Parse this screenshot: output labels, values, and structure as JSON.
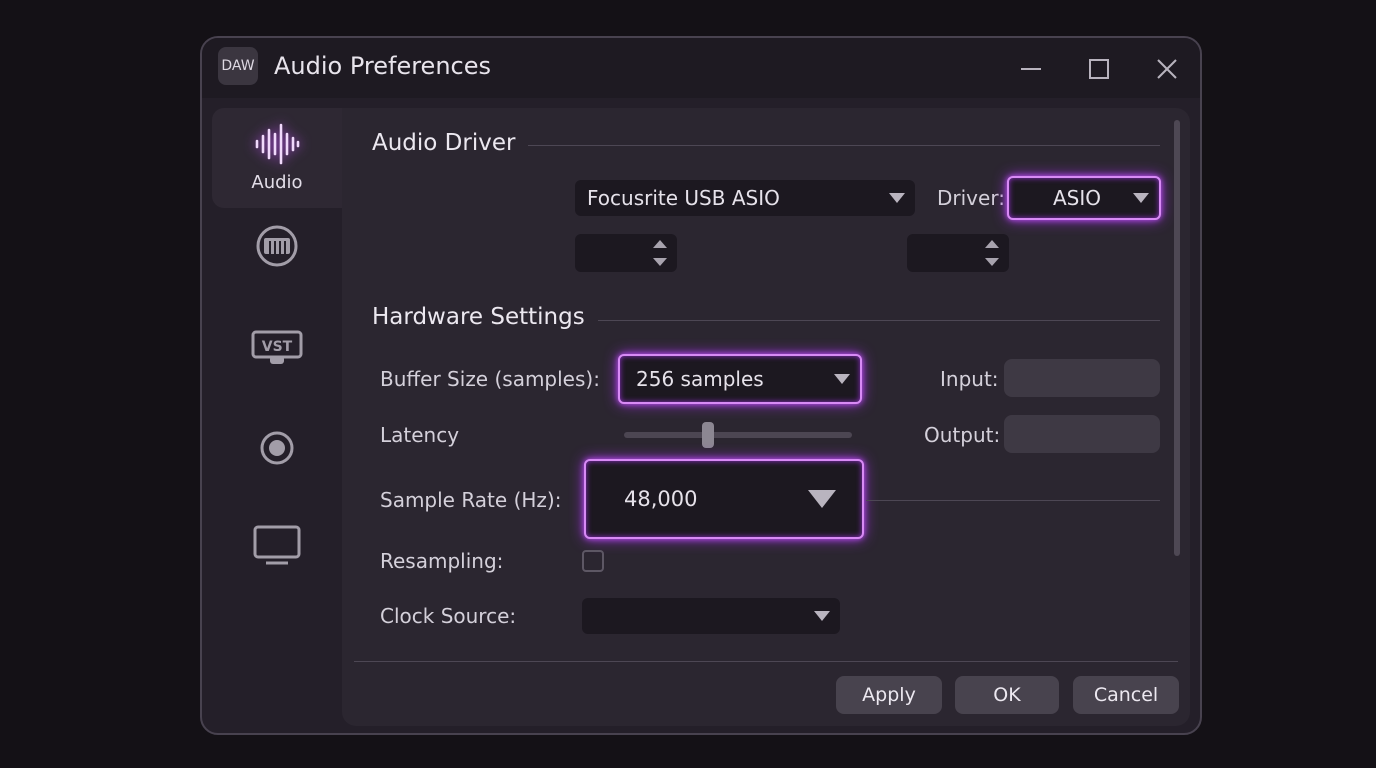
{
  "window": {
    "app_badge": "DAW",
    "title": "Audio Preferences"
  },
  "sidebar": {
    "items": [
      {
        "label": "Audio",
        "icon": "waveform-icon",
        "active": true
      },
      {
        "label": "",
        "icon": "midi-keyboard-icon",
        "active": false
      },
      {
        "label": "",
        "icon": "vst-plugin-icon",
        "active": false
      },
      {
        "label": "",
        "icon": "record-icon",
        "active": false
      },
      {
        "label": "",
        "icon": "monitor-icon",
        "active": false
      }
    ],
    "vst_text": "VST"
  },
  "audio_driver": {
    "title": "Audio Driver",
    "device_value": "Focusrite USB ASIO",
    "driver_label": "Driver:",
    "driver_value": "ASIO"
  },
  "hardware": {
    "title": "Hardware Settings",
    "buffer_label": "Buffer Size (samples):",
    "buffer_value": "256 samples",
    "input_label": "Input:",
    "latency_label": "Latency",
    "latency_level": 0.37,
    "output_label": "Output:",
    "sample_rate_label": "Sample Rate (Hz):",
    "sample_rate_value": "48,000",
    "resampling_label": "Resampling:",
    "resampling_checked": false,
    "clock_label": "Clock Source:",
    "clock_value": ""
  },
  "buttons": {
    "apply": "Apply",
    "ok": "OK",
    "cancel": "Cancel"
  },
  "colors": {
    "accent_glow": "#d88af5",
    "background": "#141116",
    "panel": "#2b2630"
  }
}
